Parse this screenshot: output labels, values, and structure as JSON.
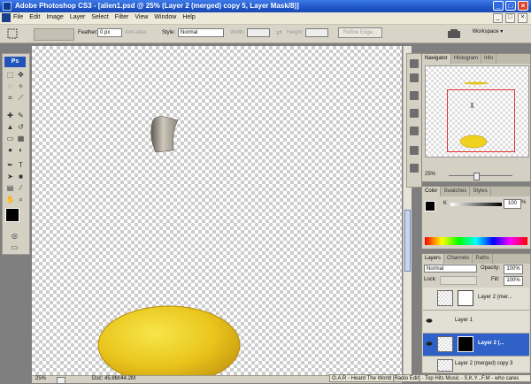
{
  "title": "Adobe Photoshop CS3 - [alien1.psd @ 25% (Layer 2 (merged) copy 5, Layer Mask/8)]",
  "menu": [
    "File",
    "Edit",
    "Image",
    "Layer",
    "Select",
    "Filter",
    "View",
    "Window",
    "Help"
  ],
  "window_controls": {
    "minimize": "_",
    "maximize": "□",
    "close": "×"
  },
  "options": {
    "feather_label": "Feather:",
    "feather_value": "0 px",
    "antialias_label": "Anti-alias",
    "style_label": "Style:",
    "style_value": "Normal",
    "width_label": "Width:",
    "height_label": "Height:",
    "refine_edge": "Refine Edge...",
    "workspace": "Workspace ▾"
  },
  "toolbox": {
    "logo": "Ps"
  },
  "status": {
    "zoom": "25%",
    "doc": "Doc: 45.8M/44.2M"
  },
  "navigator": {
    "tabs": [
      "Navigator",
      "Histogram",
      "Info"
    ],
    "zoom": "25%"
  },
  "color_panel": {
    "tabs": [
      "Color",
      "Swatches",
      "Styles"
    ],
    "channel": "K",
    "value": "100",
    "unit": "%"
  },
  "layers_panel": {
    "tabs": [
      "Layers",
      "Channels",
      "Paths"
    ],
    "blend_mode": "Normal",
    "opacity_label": "Opacity:",
    "opacity_value": "100%",
    "lock_label": "Lock:",
    "fill_label": "Fill:",
    "fill_value": "100%",
    "layers": [
      {
        "name": "Layer 2 (mer..."
      },
      {
        "name": "Layer 1"
      },
      {
        "name": "Layer 2 (..."
      },
      {
        "name": "Layer 2 (merged) copy 3"
      }
    ]
  },
  "now_playing": "O.A.R - Heard The World [Radio Edit] - Top Hits Music - S.K.Y...F.M - who cares",
  "colors": {
    "titlebar": "#1f56c9",
    "selected_layer": "#2f61c9",
    "yellow": "#f0d21e"
  }
}
